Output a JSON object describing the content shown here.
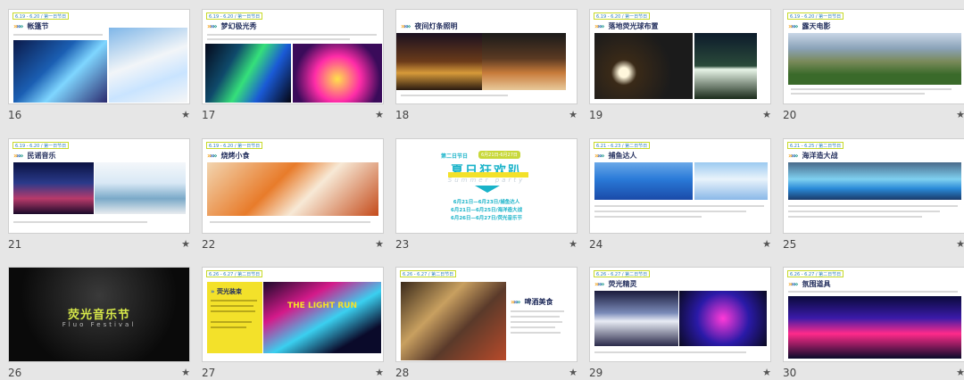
{
  "slides": [
    {
      "num": "16",
      "tag": "6.19 - 6.20 / 第一日节日",
      "title": "帐篷节"
    },
    {
      "num": "17",
      "tag": "6.19 - 6.20 / 第一日节日",
      "title": "梦幻极光秀"
    },
    {
      "num": "18",
      "tag": "6.19 - 6.20 / 第一日节日",
      "title": "夜间灯条照明"
    },
    {
      "num": "19",
      "tag": "6.19 - 6.20 / 第一日节日",
      "title": "落地荧光球布置"
    },
    {
      "num": "20",
      "tag": "6.19 - 6.20 / 第一日节日",
      "title": "露天电影"
    },
    {
      "num": "21",
      "tag": "6.19 - 6.20 / 第一日节日",
      "title": "民谣音乐"
    },
    {
      "num": "22",
      "tag": "6.19 - 6.20 / 第一日节日",
      "title": "烧烤小食"
    },
    {
      "num": "23",
      "kicker": "第二日节日",
      "pill": "6月21日-6月27日",
      "big_title": "夏日狂欢趴",
      "subtitle": "Summer party",
      "lines": [
        "6月21日—6月23日/捕鱼达人",
        "6月21日—6月25日/海洋造大战",
        "6月26日—6月27日/荧光音乐节"
      ]
    },
    {
      "num": "24",
      "tag": "6.21 - 6.23 / 第二日节日",
      "title": "捕鱼达人"
    },
    {
      "num": "25",
      "tag": "6.21 - 6.25 / 第二日节日",
      "title": "海洋造大战"
    },
    {
      "num": "26",
      "big_title": "荧光音乐节",
      "subtitle": "Fluo Festival"
    },
    {
      "num": "27",
      "tag": "6.26 - 6.27 / 第二日节日",
      "title": "荧光装束",
      "banner": "THE LIGHT RUN"
    },
    {
      "num": "28",
      "tag": "6.26 - 6.27 / 第二日节日",
      "title": "啤酒美食"
    },
    {
      "num": "29",
      "tag": "6.26 - 6.27 / 第二日节日",
      "title": "荧光精灵"
    },
    {
      "num": "30",
      "tag": "6.26 - 6.27 / 第二日节日",
      "title": "氛围道具"
    }
  ],
  "star": "★",
  "chevron": "»",
  "colors": {
    "accent_blue": "#2c7fb8",
    "accent_yellow": "#f3e12a",
    "title_navy": "#24305e",
    "teal": "#19b3c9"
  }
}
